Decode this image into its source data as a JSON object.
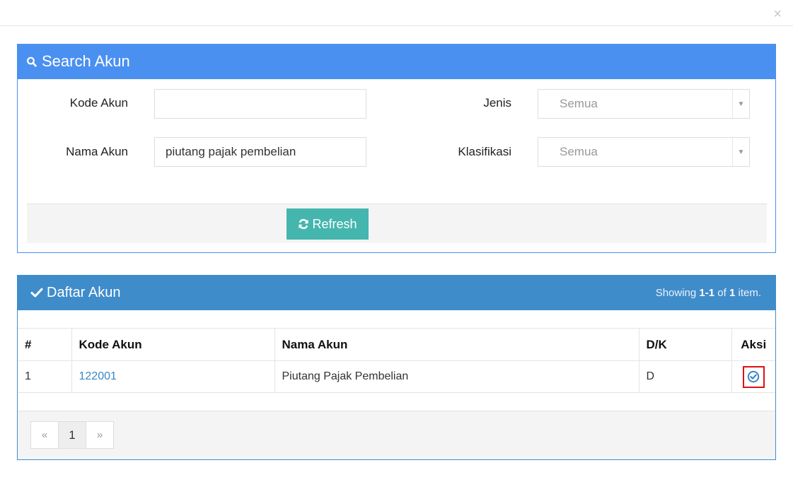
{
  "window": {
    "close_glyph": "×"
  },
  "search_panel": {
    "title": "Search Akun",
    "fields": {
      "kode_akun": {
        "label": "Kode Akun",
        "value": ""
      },
      "nama_akun": {
        "label": "Nama Akun",
        "value": "piutang pajak pembelian"
      },
      "jenis": {
        "label": "Jenis",
        "selected": "Semua"
      },
      "klasifikasi": {
        "label": "Klasifikasi",
        "selected": "Semua"
      }
    },
    "refresh_label": "Refresh"
  },
  "list_panel": {
    "title": "Daftar Akun",
    "summary": {
      "prefix": "Showing ",
      "range": "1-1",
      "middle": " of ",
      "total": "1",
      "suffix": " item."
    },
    "columns": [
      "#",
      "Kode Akun",
      "Nama Akun",
      "D/K",
      "Aksi"
    ],
    "rows": [
      {
        "no": "1",
        "kode": "122001",
        "nama": "Piutang Pajak Pembelian",
        "dk": "D"
      }
    ],
    "pagination": {
      "prev": "«",
      "current": "1",
      "next": "»"
    }
  },
  "colors": {
    "search_header": "#4a90f0",
    "list_header": "#3f8ccb",
    "refresh_button": "#44b6ae",
    "link": "#3a86c8",
    "highlight": "#e01010"
  },
  "icons": {
    "search_header": "search-icon",
    "list_header": "check-icon",
    "refresh": "refresh-icon",
    "select_row": "check-circle-icon"
  }
}
